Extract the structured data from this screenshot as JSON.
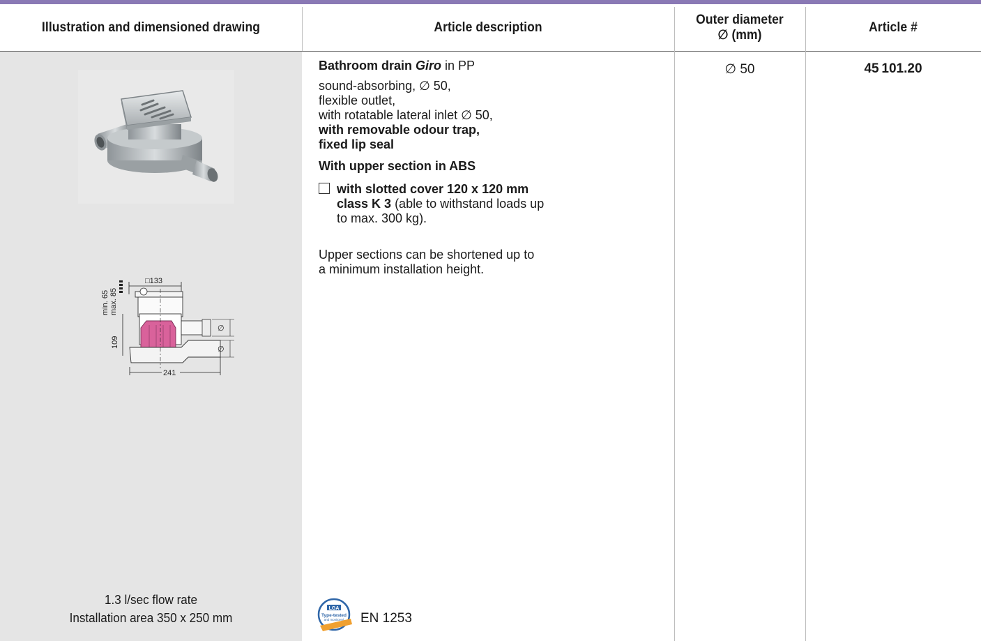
{
  "header": {
    "col1": "Illustration and dimensioned drawing",
    "col2": "Article description",
    "col3_line1": "Outer diameter",
    "col3_line2": "∅ (mm)",
    "col4": "Article #"
  },
  "drawing": {
    "min": "min. 65",
    "max": "max. 85",
    "width_top": "□133",
    "height": "109",
    "length": "241",
    "dia_symbol": "∅"
  },
  "flow": {
    "line1": "1.3 l/sec flow rate",
    "line2": "Installation area 350 x 250 mm"
  },
  "description": {
    "title_bold": "Bathroom drain ",
    "title_italic": "Giro",
    "title_rest": " in PP",
    "line1": "sound-absorbing, ∅ 50,",
    "line2": "flexible outlet,",
    "line3": "with rotatable lateral inlet ∅ 50,",
    "line4": "with removable odour trap,",
    "line5": "fixed lip seal",
    "upper": "With upper section in ABS",
    "option_bold1": "with slotted cover 120 x 120 mm",
    "option_bold2": "class K 3",
    "option_rest": " (able to withstand loads up",
    "option_rest2": "to max. 300 kg).",
    "note1": "Upper sections can be shortened up to",
    "note2": "a minimum installation height."
  },
  "outer_diameter": "∅ 50",
  "article_number": "45 101.20",
  "certification": {
    "badge_top": "LGA",
    "badge_mid": "Type-tested",
    "badge_sub": "and monitored",
    "standard": "EN 1253"
  },
  "colors": {
    "accent_bar": "#8a79b5",
    "left_panel": "#e5e5e5",
    "trap_pink": "#d9629b"
  }
}
